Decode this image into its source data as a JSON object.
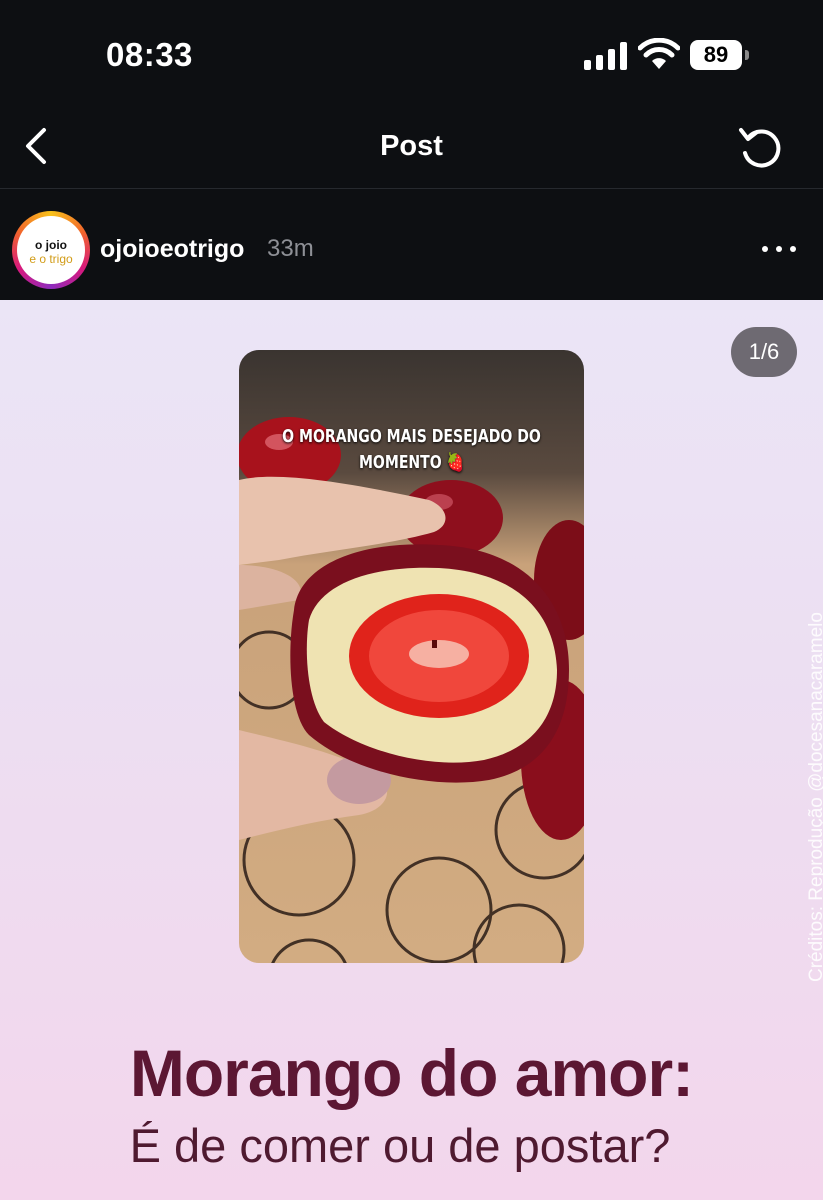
{
  "status_bar": {
    "time": "08:33",
    "battery": "89"
  },
  "nav": {
    "title": "Post"
  },
  "post": {
    "avatar_line1": "o joio",
    "avatar_line2": "e o trigo",
    "username": "ojoioeotrigo",
    "time_ago": "33m"
  },
  "image": {
    "counter": "1/6",
    "caption_line1": "O MORANGO MAIS DESEJADO DO",
    "caption_line2": "MOMENTO 🍓",
    "credits": "Créditos: Reprodução @docesanacaramelo",
    "headline": "Morango do amor:",
    "subline": "É de comer ou de postar?"
  }
}
